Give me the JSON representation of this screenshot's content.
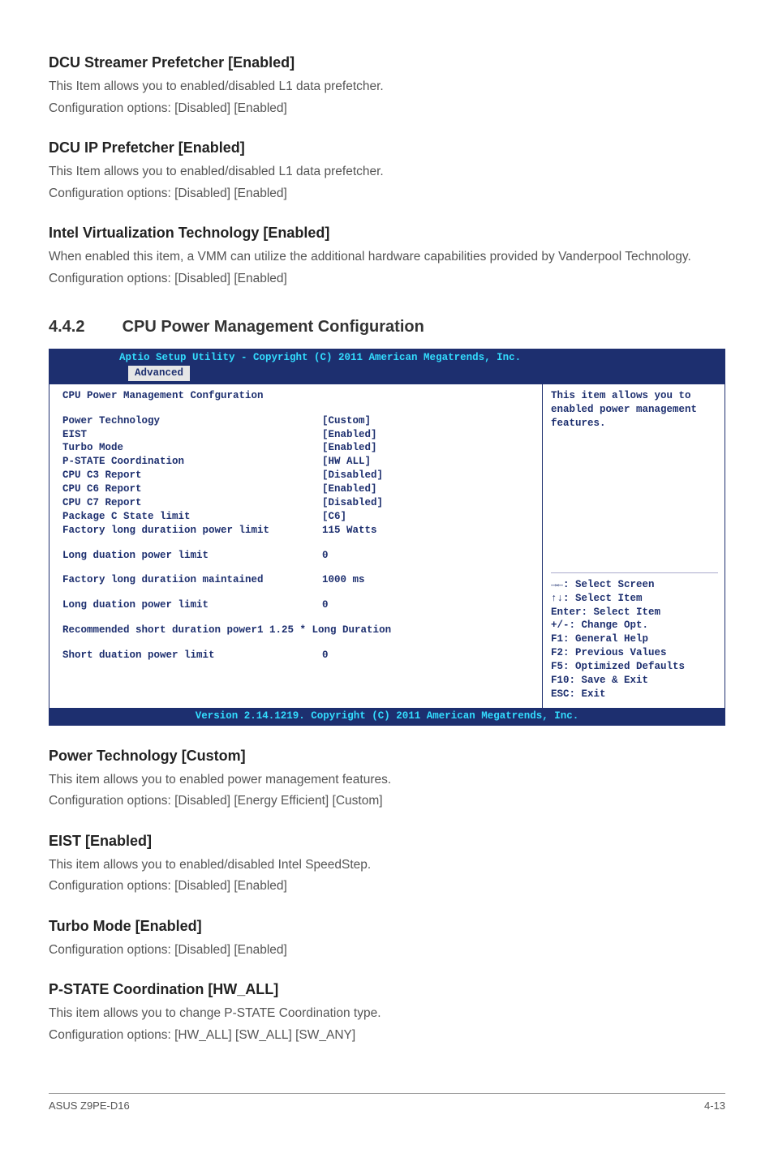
{
  "s1": {
    "title": "DCU Streamer Prefetcher [Enabled]",
    "p1": "This Item allows you to enabled/disabled L1 data prefetcher.",
    "p2": "Configuration options: [Disabled] [Enabled]"
  },
  "s2": {
    "title": "DCU IP Prefetcher [Enabled]",
    "p1": "This Item allows you to enabled/disabled L1 data prefetcher.",
    "p2": "Configuration options: [Disabled] [Enabled]"
  },
  "s3": {
    "title": "Intel Virtualization Technology [Enabled]",
    "p1": "When enabled this item, a VMM can utilize the additional hardware capabilities provided by Vanderpool Technology.",
    "p2": "Configuration options: [Disabled] [Enabled]"
  },
  "section": {
    "number": "4.4.2",
    "title": "CPU Power Management Configuration"
  },
  "bios": {
    "header": "Aptio Setup Utility - Copyright (C) 2011 American Megatrends, Inc.",
    "tab": "Advanced",
    "panel_title": "CPU Power Management Confguration",
    "rows": {
      "r1l": "Power Technology",
      "r1v": "[Custom]",
      "r2l": "EIST",
      "r2v": "[Enabled]",
      "r3l": "Turbo Mode",
      "r3v": "[Enabled]",
      "r4l": "P-STATE Coordination",
      "r4v": "[HW ALL]",
      "r5l": "CPU C3 Report",
      "r5v": "[Disabled]",
      "r6l": "CPU C6 Report",
      "r6v": "[Enabled]",
      "r7l": "CPU C7 Report",
      "r7v": "[Disabled]",
      "r8l": "Package C State limit",
      "r8v": "[C6]",
      "r9l": "Factory long duratiion power limit",
      "r9v": "115 Watts",
      "r10l": "Long duation power limit",
      "r10v": "0",
      "r11l": "Factory long duratiion maintained",
      "r11v": "1000 ms",
      "r12l": "Long duation power limit",
      "r12v": "0",
      "r13l": "Recommended short duration power1 1.25 * Long Duration",
      "r14l": "Short duation power limit",
      "r14v": "0"
    },
    "side": {
      "desc": "This item allows you to enabled power management features.",
      "k1": "→←: Select Screen",
      "k2": "↑↓:  Select Item",
      "k3": "Enter: Select Item",
      "k4": "+/-: Change Opt.",
      "k5": "F1: General Help",
      "k6": "F2: Previous Values",
      "k7": "F5: Optimized Defaults",
      "k8": "F10: Save & Exit",
      "k9": "ESC: Exit"
    },
    "footer": "Version 2.14.1219. Copyright (C) 2011 American Megatrends, Inc."
  },
  "s4": {
    "title": "Power Technology [Custom]",
    "p1": "This item allows you to enabled power management features.",
    "p2": "Configuration options: [Disabled] [Energy Efficient] [Custom]"
  },
  "s5": {
    "title": "EIST [Enabled]",
    "p1": "This item allows you to enabled/disabled Intel SpeedStep.",
    "p2": "Configuration options: [Disabled] [Enabled]"
  },
  "s6": {
    "title": "Turbo Mode [Enabled]",
    "p1": "Configuration options: [Disabled] [Enabled]"
  },
  "s7": {
    "title": "P-STATE Coordination [HW_ALL]",
    "p1": "This item allows you to change P-STATE Coordination type.",
    "p2": "Configuration options: [HW_ALL] [SW_ALL] [SW_ANY]"
  },
  "footer": {
    "left": "ASUS Z9PE-D16",
    "right": "4-13"
  }
}
